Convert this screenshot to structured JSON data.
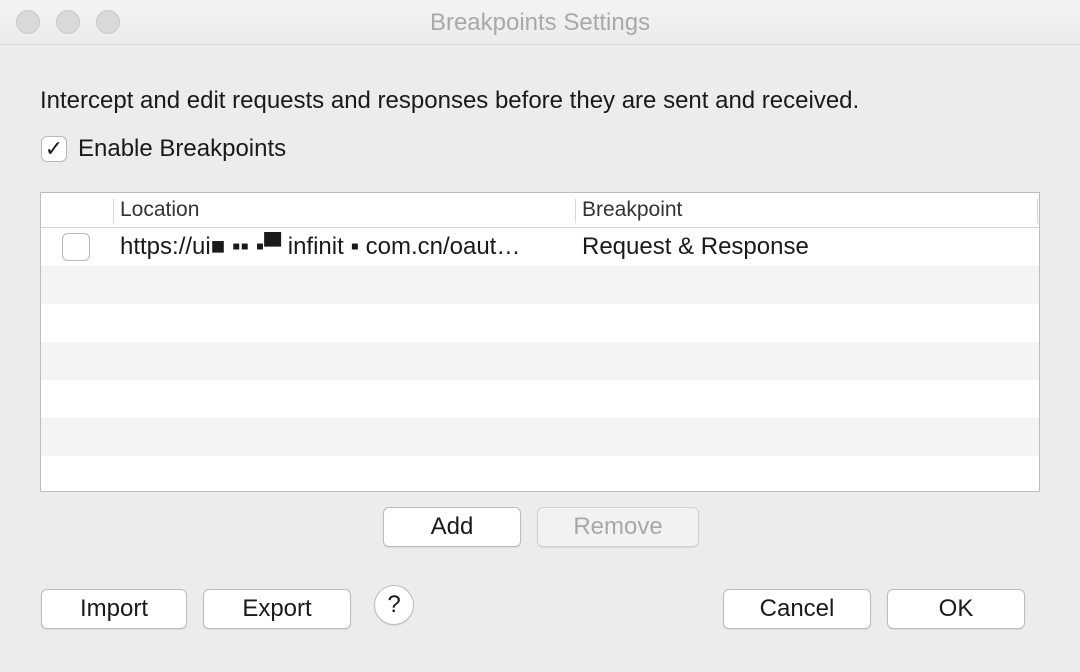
{
  "window": {
    "title": "Breakpoints Settings"
  },
  "description": "Intercept and edit requests and responses before they are sent and received.",
  "enable": {
    "label": "Enable Breakpoints",
    "checked": true,
    "check_glyph": "✓"
  },
  "table": {
    "columns": [
      "Location",
      "Breakpoint"
    ],
    "rows": [
      {
        "enabled": false,
        "location": "https://ui■ ▪▪ ▪▀ infinit ▪ com.cn/oaut…",
        "breakpoint": "Request & Response"
      }
    ]
  },
  "buttons": {
    "add": "Add",
    "remove": "Remove",
    "import": "Import",
    "export": "Export",
    "help": "?",
    "cancel": "Cancel",
    "ok": "OK"
  },
  "colors": {
    "background": "#ececec",
    "title_text": "#a9a9a9",
    "alt_row": "#f4f4f4"
  }
}
